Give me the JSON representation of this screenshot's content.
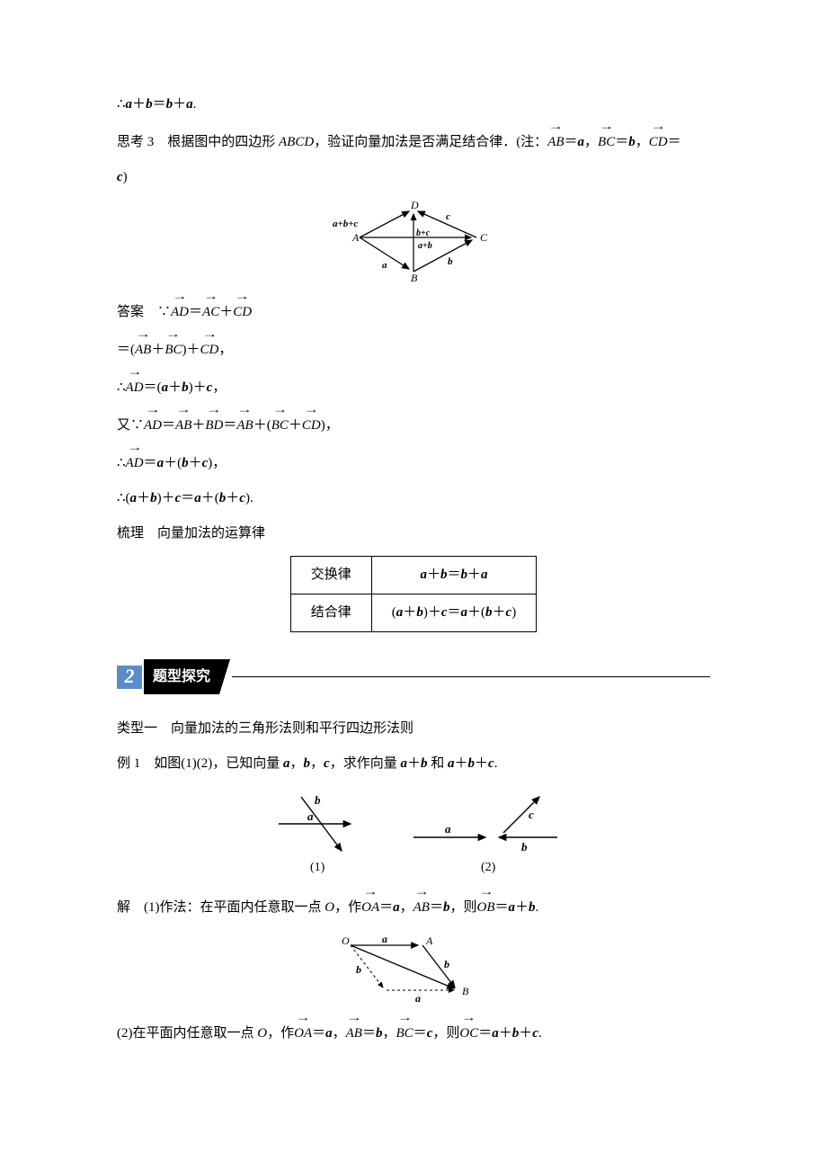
{
  "line1_pre": "∴",
  "line1_a": "a",
  "line1_p1": "＋",
  "line1_b": "b",
  "line1_eq": "＝",
  "line1_b2": "b",
  "line1_p2": "＋",
  "line1_a2": "a",
  "line1_dot": ".",
  "sk3_label": "思考 3　根据图中的四边形 ",
  "sk3_abcd": "ABCD",
  "sk3_mid": "，验证向量加法是否满足结合律．(注：",
  "sk3_v1": "AB",
  "sk3_eq": "＝",
  "sk3_a": "a",
  "sk3_c1": "，",
  "sk3_v2": "BC",
  "sk3_b": "b",
  "sk3_c2": "，",
  "sk3_v3": "CD",
  "sk3_c": "c",
  "sk3_end": ")",
  "fig1": {
    "A": "A",
    "B": "B",
    "C": "C",
    "D": "D",
    "a": "a",
    "b": "b",
    "c": "c",
    "abc": "a+b+c",
    "bc": "b+c",
    "ab": "a+b"
  },
  "ans_label": "答案　∵",
  "ans_AD": "AD",
  "ans_AC": "AC",
  "ans_CD": "CD",
  "ans_AB": "AB",
  "ans_BC": "BC",
  "ans_BD": "BD",
  "eq": "＝",
  "plus": "＋",
  "comma": "，",
  "therefore": "∴",
  "also_because": "又∵",
  "period": ".",
  "lp": "(",
  "rp": ")",
  "a": "a",
  "b": "b",
  "c": "c",
  "shuli": "梳理　向量加法的运算律",
  "law1_name": "交换律",
  "law1_expr_a1": "a",
  "law1_p1": "＋",
  "law1_b1": "b",
  "law1_eq": "＝",
  "law1_b2": "b",
  "law1_p2": "＋",
  "law1_a2": "a",
  "law2_name": "结合律",
  "law2_lp1": "(",
  "law2_a1": "a",
  "law2_p1": "＋",
  "law2_b1": "b",
  "law2_rp1": ")",
  "law2_p2": "＋",
  "law2_c1": "c",
  "law2_eq": "＝",
  "law2_a2": "a",
  "law2_p3": "＋",
  "law2_lp2": "(",
  "law2_b2": "b",
  "law2_p4": "＋",
  "law2_c2": "c",
  "law2_rp2": ")",
  "sec_num": "2",
  "sec_title": "题型探究",
  "type1": "类型一　向量加法的三角形法则和平行四边形法则",
  "ex1_label": "例 1　如图(1)(2)，已知向量 ",
  "ex1_mid1": "，",
  "ex1_mid2": "，",
  "ex1_mid3": "，求作向量 ",
  "ex1_and": " 和 ",
  "ex1_end": ".",
  "fig2": {
    "a": "a",
    "b": "b",
    "c": "c",
    "n1": "(1)",
    "n2": "(2)"
  },
  "sol_label": "解　(1)作法：在平面内任意取一点 ",
  "sol_O": "O",
  "sol_mid1": "，作",
  "sol_OA": "OA",
  "sol_AB": "AB",
  "sol_OB": "OB",
  "fig3": {
    "O": "O",
    "A": "A",
    "B": "B",
    "a": "a",
    "b": "b"
  },
  "sol2_pre": "(2)在平面内任意取一点 ",
  "sol2_OC": "OC",
  "sol2_BC": "BC"
}
